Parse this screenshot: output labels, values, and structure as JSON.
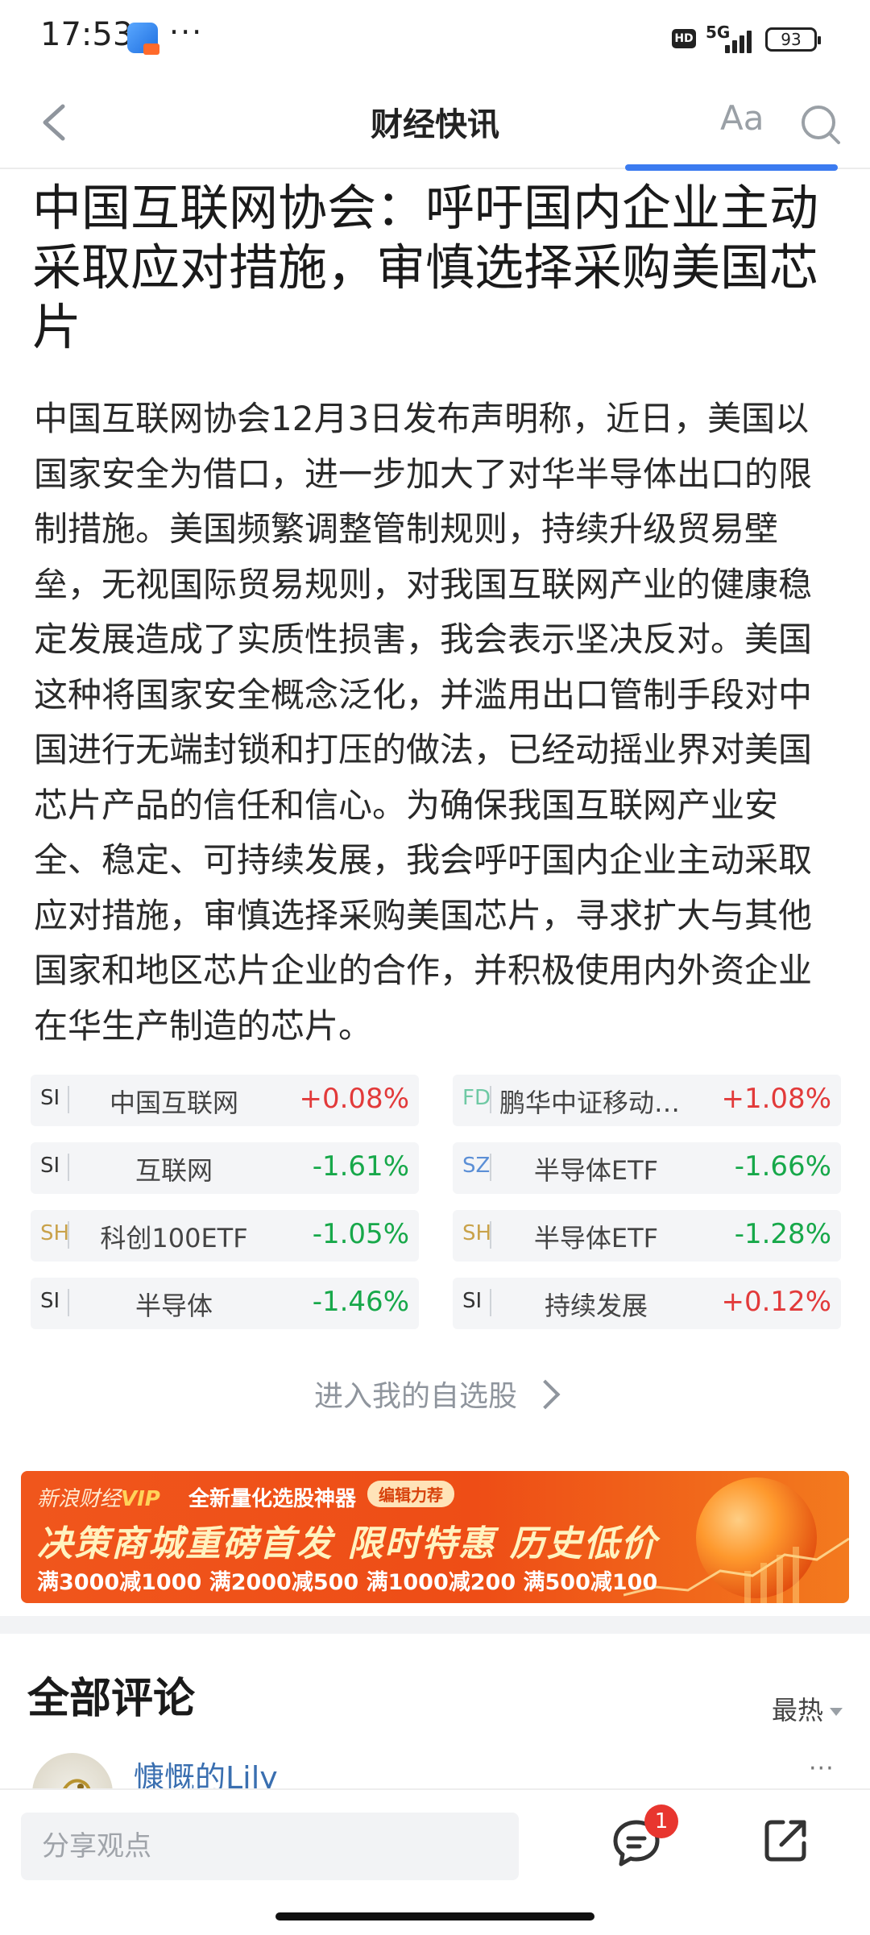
{
  "status_bar": {
    "time": "17:53",
    "more": "···",
    "hd": "HD",
    "network": "5G",
    "battery": "93"
  },
  "nav": {
    "title": "财经快讯",
    "font_label": "Aa",
    "icons": [
      "back-icon",
      "search-icon"
    ]
  },
  "article": {
    "title": "中国互联网协会：呼吁国内企业主动采取应对措施，审慎选择采购美国芯片",
    "body": "中国互联网协会12月3日发布声明称，近日，美国以国家安全为借口，进一步加大了对华半导体出口的限制措施。美国频繁调整管制规则，持续升级贸易壁垒，无视国际贸易规则，对我国互联网产业的健康稳定发展造成了实质性损害，我会表示坚决反对。美国这种将国家安全概念泛化，并滥用出口管制手段对中国进行无端封锁和打压的做法，已经动摇业界对美国芯片产品的信任和信心。为确保我国互联网产业安全、稳定、可持续发展，我会呼吁国内企业主动采取应对措施，审慎选择采购美国芯片，寻求扩大与其他国家和地区芯片企业的合作，并积极使用内外资企业在华生产制造的芯片。"
  },
  "stocks": [
    {
      "market": "SI",
      "name": "中国互联网",
      "change": "+0.08%",
      "direction": "up",
      "market_color": "#333333"
    },
    {
      "market": "FD",
      "name": "鹏华中证移动互联…",
      "change": "+1.08%",
      "direction": "up",
      "market_color": "#6fc9a4"
    },
    {
      "market": "SI",
      "name": "互联网",
      "change": "-1.61%",
      "direction": "down",
      "market_color": "#333333"
    },
    {
      "market": "SZ",
      "name": "半导体ETF",
      "change": "-1.66%",
      "direction": "down",
      "market_color": "#5b8fd6"
    },
    {
      "market": "SH",
      "name": "科创100ETF",
      "change": "-1.05%",
      "direction": "down",
      "market_color": "#c9a24a"
    },
    {
      "market": "SH",
      "name": "半导体ETF",
      "change": "-1.28%",
      "direction": "down",
      "market_color": "#c9a24a"
    },
    {
      "market": "SI",
      "name": "半导体",
      "change": "-1.46%",
      "direction": "down",
      "market_color": "#333333"
    },
    {
      "market": "SI",
      "name": "持续发展",
      "change": "+0.12%",
      "direction": "up",
      "market_color": "#333333"
    }
  ],
  "watchlist_link": "进入我的自选股",
  "ad": {
    "brand": "新浪财经",
    "brand_vip": "VIP",
    "tagline": "全新量化选股神器",
    "badge": "编辑力荐",
    "headline": "决策商城重磅首发  限时特惠  历史低价",
    "offers": "满3000减1000 满2000减500 满1000减200 满500减100"
  },
  "comments": {
    "title": "全部评论",
    "sort": "最热",
    "first_user": "慷慨的Lily",
    "more": "···"
  },
  "bottom_bar": {
    "input_placeholder": "分享观点",
    "comment_count": "1"
  },
  "colors": {
    "up": "#e23a3a",
    "down": "#17a84a",
    "accent": "#3b7bf0"
  }
}
